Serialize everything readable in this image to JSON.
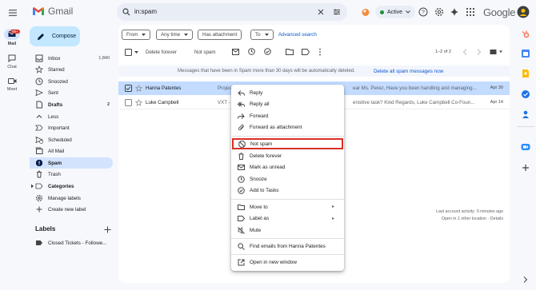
{
  "app": {
    "name": "Gmail"
  },
  "search": {
    "query": "in:spam"
  },
  "status": {
    "label": "Active"
  },
  "google": "Google",
  "rail": {
    "mail": "Mail",
    "chat": "Chat",
    "meet": "Meet",
    "badge": "99+"
  },
  "compose": "Compose",
  "nav": [
    {
      "label": "Inbox",
      "count": "1,840",
      "icon": "inbox-icon"
    },
    {
      "label": "Starred",
      "count": "",
      "icon": "star-icon"
    },
    {
      "label": "Snoozed",
      "count": "",
      "icon": "clock-icon"
    },
    {
      "label": "Sent",
      "count": "",
      "icon": "send-icon"
    },
    {
      "label": "Drafts",
      "count": "2",
      "icon": "draft-icon"
    },
    {
      "label": "Less",
      "count": "",
      "icon": "chevron-up-icon"
    },
    {
      "label": "Important",
      "count": "",
      "icon": "important-icon"
    },
    {
      "label": "Scheduled",
      "count": "",
      "icon": "scheduled-icon"
    },
    {
      "label": "All Mail",
      "count": "",
      "icon": "all-mail-icon"
    },
    {
      "label": "Spam",
      "count": "",
      "icon": "spam-icon"
    },
    {
      "label": "Trash",
      "count": "",
      "icon": "trash-icon"
    },
    {
      "label": "Categories",
      "count": "",
      "icon": "label-icon"
    },
    {
      "label": "Manage labels",
      "count": "",
      "icon": "gear-icon"
    },
    {
      "label": "Create new label",
      "count": "",
      "icon": "plus-icon"
    }
  ],
  "labels": {
    "title": "Labels",
    "items": [
      "Closed Tickets - Followe..."
    ]
  },
  "filters": {
    "from": "From",
    "anytime": "Any time",
    "attachment": "Has attachment",
    "to": "To",
    "advanced": "Advanced search"
  },
  "toolbar": {
    "delete_forever": "Delete forever",
    "not_spam": "Not spam",
    "range": "1–2 of 2"
  },
  "notice": {
    "text": "Messages that have been in Spam more than 30 days will be automatically deleted.",
    "action": "Delete all spam messages now"
  },
  "emails": [
    {
      "sender": "Hanna Patentes",
      "subject": "Projec",
      "snippet": "ear Ms. Perez, Have you been handling and managing...",
      "date": "Apr 30",
      "selected": true
    },
    {
      "sender": "Luke Campbell",
      "subject": "VXT -",
      "snippet": "ensitive task? Kind Regards, Luke Campbell Co-Foun...",
      "date": "Apr 14",
      "selected": false
    }
  ],
  "account": {
    "activity": "Last account activity: 0 minutes ago",
    "location": "Open in 1 other location · Details"
  },
  "context_menu": {
    "items": [
      {
        "label": "Reply",
        "icon": "reply-icon"
      },
      {
        "label": "Reply all",
        "icon": "reply-all-icon"
      },
      {
        "label": "Forward",
        "icon": "forward-icon"
      },
      {
        "label": "Forward as attachment",
        "icon": "attachment-icon"
      },
      {
        "label": "Not spam",
        "icon": "not-spam-icon"
      },
      {
        "label": "Delete forever",
        "icon": "trash-icon"
      },
      {
        "label": "Mark as unread",
        "icon": "mail-icon"
      },
      {
        "label": "Snooze",
        "icon": "clock-icon"
      },
      {
        "label": "Add to Tasks",
        "icon": "task-icon"
      },
      {
        "label": "Move to",
        "icon": "folder-icon"
      },
      {
        "label": "Label as",
        "icon": "label-icon"
      },
      {
        "label": "Mute",
        "icon": "mute-icon"
      },
      {
        "label": "Find emails from Hanna Patentes",
        "icon": "search-icon"
      },
      {
        "label": "Open in new window",
        "icon": "open-window-icon"
      }
    ]
  },
  "colors": {
    "accent": "#0b57d0",
    "highlight": "#d93025",
    "selected_row": "#c2dbff"
  }
}
